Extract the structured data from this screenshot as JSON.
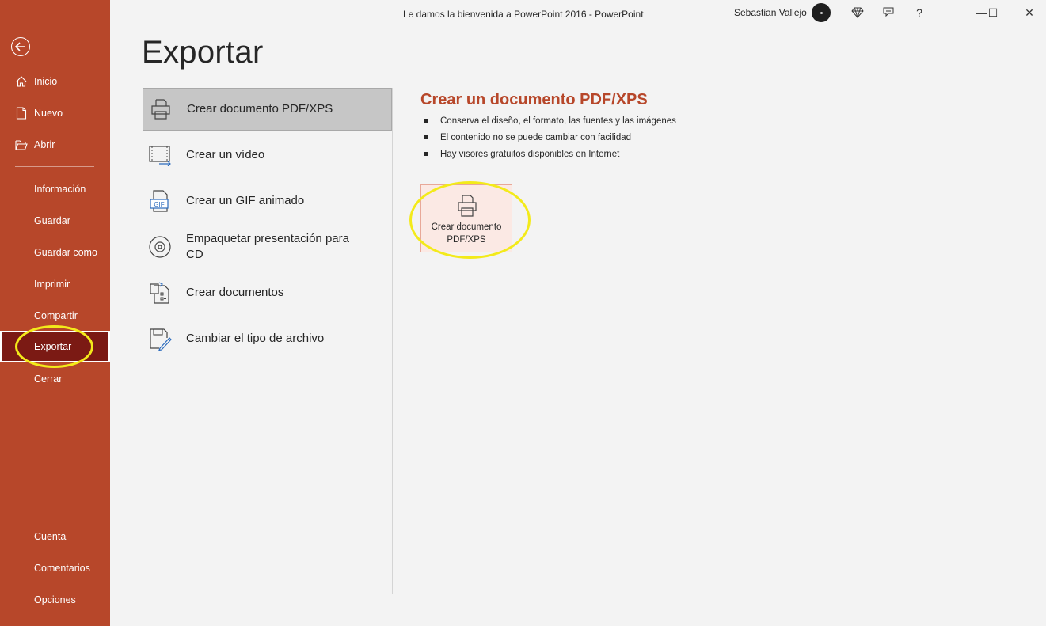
{
  "window": {
    "title": "Le damos la bienvenida a PowerPoint 2016  -  PowerPoint"
  },
  "account": {
    "user_name": "Sebastian Vallejo"
  },
  "titlebar_buttons": {
    "help": "?",
    "minimize": "—",
    "maximize": "☐",
    "close": "✕"
  },
  "nav": {
    "top_items": [
      {
        "label": "Inicio",
        "icon": "home-icon"
      },
      {
        "label": "Nuevo",
        "icon": "new-document-icon"
      },
      {
        "label": "Abrir",
        "icon": "open-folder-icon"
      }
    ],
    "middle_items": [
      {
        "label": "Información"
      },
      {
        "label": "Guardar"
      },
      {
        "label": "Guardar como"
      },
      {
        "label": "Imprimir"
      },
      {
        "label": "Compartir"
      },
      {
        "label": "Exportar",
        "active": true
      },
      {
        "label": "Cerrar"
      }
    ],
    "bottom_items": [
      {
        "label": "Cuenta"
      },
      {
        "label": "Comentarios"
      },
      {
        "label": "Opciones"
      }
    ]
  },
  "page": {
    "title": "Exportar"
  },
  "export_options": [
    {
      "label": "Crear documento PDF/XPS",
      "icon": "pdf-document-icon",
      "selected": true
    },
    {
      "label": "Crear un vídeo",
      "icon": "video-icon"
    },
    {
      "label": "Crear un GIF animado",
      "icon": "gif-icon",
      "icon_text": "GIF"
    },
    {
      "label": "Empaquetar presentación para CD",
      "icon": "cd-icon"
    },
    {
      "label": "Crear documentos",
      "icon": "handouts-icon"
    },
    {
      "label": "Cambiar el tipo de archivo",
      "icon": "change-file-type-icon"
    }
  ],
  "detail": {
    "title": "Crear un documento PDF/XPS",
    "bullets": [
      "Conserva el diseño, el formato, las fuentes y las imágenes",
      "El contenido no se puede cambiar con facilidad",
      "Hay visores gratuitos disponibles en Internet"
    ],
    "action_button": {
      "label": "Crear documento PDF/XPS",
      "icon": "pdf-document-icon"
    }
  },
  "colors": {
    "accent": "#b7472a",
    "nav_active": "#7b1a14",
    "highlight": "#f3ea1a",
    "selected_option": "#c6c6c6"
  }
}
